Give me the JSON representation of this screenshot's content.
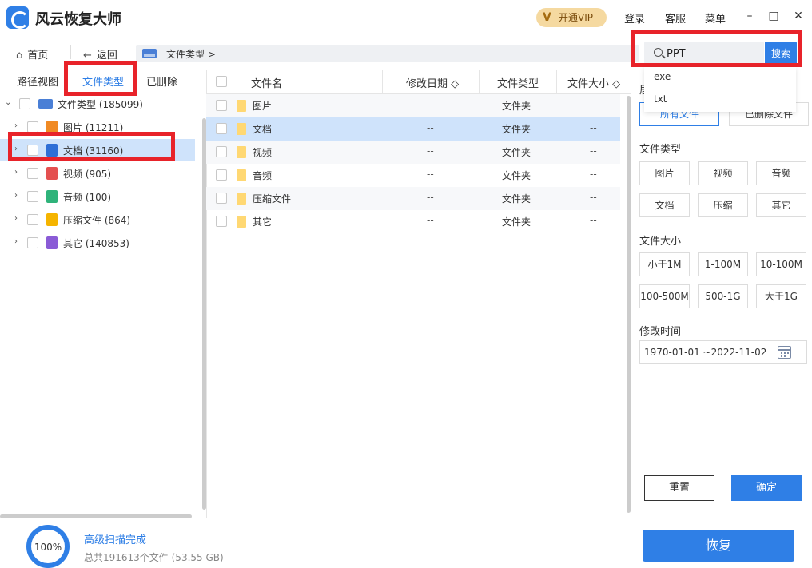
{
  "titlebar": {
    "app_name": "风云恢复大师",
    "vip_label": "开通VIP",
    "vip_icon": "V",
    "login": "登录",
    "service": "客服",
    "menu": "菜单",
    "minimize": "–",
    "maximize": "□",
    "close": "✕"
  },
  "nav": {
    "home": "首页",
    "home_icon": "⌂",
    "back": "返回",
    "back_icon": "←",
    "path": "文件类型  >"
  },
  "search": {
    "value": "PPT",
    "button": "搜索",
    "suggestions": [
      "exe",
      "txt"
    ]
  },
  "left_tabs": [
    "路径视图",
    "文件类型",
    "已删除"
  ],
  "active_left_tab": 1,
  "tree": {
    "root": "文件类型 (185099)",
    "items": [
      {
        "label": "图片 (11211)",
        "color": "#f08a24"
      },
      {
        "label": "文档 (31160)",
        "color": "#2f6fd6"
      },
      {
        "label": "视频 (905)",
        "color": "#e45050"
      },
      {
        "label": "音频 (100)",
        "color": "#2fb37a"
      },
      {
        "label": "压缩文件 (864)",
        "color": "#f5b400"
      },
      {
        "label": "其它 (140853)",
        "color": "#8a5bd6"
      }
    ]
  },
  "table": {
    "headers": {
      "name": "文件名",
      "date": "修改日期 ◇",
      "type": "文件类型",
      "size": "文件大小 ◇"
    },
    "rows": [
      {
        "name": "图片",
        "date": "--",
        "type": "文件夹",
        "size": "--"
      },
      {
        "name": "文档",
        "date": "--",
        "type": "文件夹",
        "size": "--"
      },
      {
        "name": "视频",
        "date": "--",
        "type": "文件夹",
        "size": "--"
      },
      {
        "name": "音频",
        "date": "--",
        "type": "文件夹",
        "size": "--"
      },
      {
        "name": "压缩文件",
        "date": "--",
        "type": "文件夹",
        "size": "--"
      },
      {
        "name": "其它",
        "date": "--",
        "type": "文件夹",
        "size": "--"
      }
    ]
  },
  "filter": {
    "cut_label": "居",
    "status": [
      "所有文件",
      "已删除文件"
    ],
    "type_title": "文件类型",
    "types": [
      "图片",
      "视频",
      "音频",
      "文档",
      "压缩",
      "其它"
    ],
    "size_title": "文件大小",
    "sizes": [
      "小于1M",
      "1-100M",
      "10-100M",
      "100-500M",
      "500-1G",
      "大于1G"
    ],
    "time_title": "修改时间",
    "date_range": "1970-01-01 ~2022-11-02",
    "reset": "重置",
    "confirm": "确定"
  },
  "bottom": {
    "progress": "100%",
    "status": "高级扫描完成",
    "total": "总共191613个文件 (53.55 GB)",
    "recover": "恢复"
  },
  "accent_color": "#2f7fe6",
  "highlight_color": "#e8232a"
}
